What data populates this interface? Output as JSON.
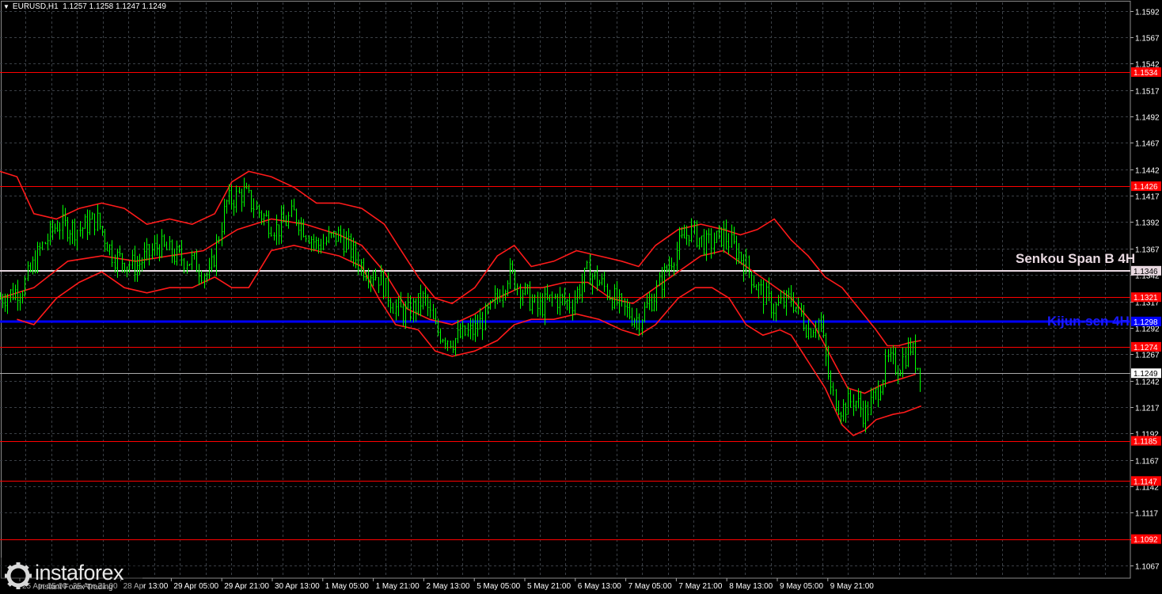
{
  "header": {
    "symbol": "EURUSD,H1",
    "ohlc": "1.1257 1.1258 1.1247 1.1249"
  },
  "watermark": {
    "brand": "instaforex",
    "tagline": "Instant Forex Trading"
  },
  "colors": {
    "background": "#000000",
    "grid": "#3a3f45",
    "candle": "#00ff00",
    "ichimoku": "#ff1a1a",
    "level": "#ff0000",
    "kijun": "#0000ff",
    "senkou": "#e8d8e0",
    "axis_text": "#ffffff",
    "price_tag_text": "#ffffff",
    "current_tag_bg": "#ffffff"
  },
  "chart_data": {
    "type": "candlestick",
    "ylim": [
      1.1055,
      1.16
    ],
    "y_ticks": [
      "1.1592",
      "1.1567",
      "1.1542",
      "1.1517",
      "1.1492",
      "1.1467",
      "1.1442",
      "1.1417",
      "1.1392",
      "1.1367",
      "1.1342",
      "1.1317",
      "1.1292",
      "1.1267",
      "1.1242",
      "1.1217",
      "1.1192",
      "1.1167",
      "1.1142",
      "1.1117",
      "1.1092",
      "1.1067"
    ],
    "x_ticks": [
      "25 Apr 05:00",
      "25 Apr 21:00",
      "28 Apr 13:00",
      "29 Apr 05:00",
      "29 Apr 21:00",
      "30 Apr 13:00",
      "1 May 05:00",
      "1 May 21:00",
      "2 May 13:00",
      "5 May 05:00",
      "5 May 21:00",
      "6 May 13:00",
      "7 May 05:00",
      "7 May 21:00",
      "8 May 13:00",
      "9 May 05:00",
      "9 May 21:00"
    ],
    "levels": [
      {
        "price": 1.1534,
        "label": "1.1534",
        "color": "#ff0000"
      },
      {
        "price": 1.1426,
        "label": "1.1426",
        "color": "#ff0000"
      },
      {
        "price": 1.1321,
        "label": "1.1321",
        "color": "#ff0000"
      },
      {
        "price": 1.1274,
        "label": "1.1274",
        "color": "#ff0000"
      },
      {
        "price": 1.1185,
        "label": "1.1185",
        "color": "#ff0000"
      },
      {
        "price": 1.1147,
        "label": "1.1147",
        "color": "#ff0000"
      },
      {
        "price": 1.1092,
        "label": "1.1092",
        "color": "#ff0000"
      }
    ],
    "kijun": {
      "price": 1.1298,
      "label": "1.1298",
      "name": "Kijun-sen 4H"
    },
    "senkou": {
      "price": 1.1346,
      "label": "1.1346",
      "name": "Senkou Span B 4H"
    },
    "current_price": {
      "price": 1.1249,
      "label": "1.1249"
    },
    "series": [
      {
        "name": "close_path",
        "points": [
          [
            0,
            1.132
          ],
          [
            0.02,
            1.133
          ],
          [
            0.035,
            1.1365
          ],
          [
            0.05,
            1.139
          ],
          [
            0.07,
            1.1385
          ],
          [
            0.085,
            1.1395
          ],
          [
            0.1,
            1.136
          ],
          [
            0.12,
            1.135
          ],
          [
            0.14,
            1.137
          ],
          [
            0.155,
            1.136
          ],
          [
            0.17,
            1.1355
          ],
          [
            0.185,
            1.134
          ],
          [
            0.2,
            1.141
          ],
          [
            0.215,
            1.142
          ],
          [
            0.23,
            1.14
          ],
          [
            0.245,
            1.1385
          ],
          [
            0.26,
            1.14
          ],
          [
            0.28,
            1.137
          ],
          [
            0.3,
            1.138
          ],
          [
            0.32,
            1.135
          ],
          [
            0.335,
            1.134
          ],
          [
            0.35,
            1.131
          ],
          [
            0.36,
            1.1305
          ],
          [
            0.375,
            1.132
          ],
          [
            0.385,
            1.129
          ],
          [
            0.4,
            1.128
          ],
          [
            0.42,
            1.129
          ],
          [
            0.435,
            1.131
          ],
          [
            0.45,
            1.1345
          ],
          [
            0.46,
            1.133
          ],
          [
            0.475,
            1.131
          ],
          [
            0.49,
            1.132
          ],
          [
            0.505,
            1.1315
          ],
          [
            0.52,
            1.1345
          ],
          [
            0.535,
            1.133
          ],
          [
            0.55,
            1.131
          ],
          [
            0.565,
            1.13
          ],
          [
            0.58,
            1.1325
          ],
          [
            0.595,
            1.136
          ],
          [
            0.61,
            1.1385
          ],
          [
            0.625,
            1.137
          ],
          [
            0.64,
            1.138
          ],
          [
            0.655,
            1.136
          ],
          [
            0.67,
            1.133
          ],
          [
            0.685,
            1.131
          ],
          [
            0.7,
            1.132
          ],
          [
            0.715,
            1.129
          ],
          [
            0.725,
            1.13
          ],
          [
            0.735,
            1.123
          ],
          [
            0.745,
            1.1215
          ],
          [
            0.755,
            1.1225
          ],
          [
            0.765,
            1.121
          ],
          [
            0.775,
            1.123
          ],
          [
            0.785,
            1.126
          ],
          [
            0.795,
            1.1255
          ],
          [
            0.805,
            1.1275
          ],
          [
            0.81,
            1.126
          ],
          [
            0.815,
            1.1249
          ]
        ]
      },
      {
        "name": "upper_band",
        "points": [
          [
            0,
            1.144
          ],
          [
            0.015,
            1.1435
          ],
          [
            0.03,
            1.14
          ],
          [
            0.05,
            1.1395
          ],
          [
            0.07,
            1.1405
          ],
          [
            0.09,
            1.141
          ],
          [
            0.11,
            1.1405
          ],
          [
            0.13,
            1.139
          ],
          [
            0.15,
            1.1395
          ],
          [
            0.17,
            1.139
          ],
          [
            0.19,
            1.14
          ],
          [
            0.205,
            1.143
          ],
          [
            0.22,
            1.144
          ],
          [
            0.24,
            1.1435
          ],
          [
            0.26,
            1.1425
          ],
          [
            0.28,
            1.141
          ],
          [
            0.3,
            1.141
          ],
          [
            0.32,
            1.1405
          ],
          [
            0.34,
            1.139
          ],
          [
            0.355,
            1.1365
          ],
          [
            0.37,
            1.134
          ],
          [
            0.385,
            1.132
          ],
          [
            0.4,
            1.1315
          ],
          [
            0.42,
            1.133
          ],
          [
            0.44,
            1.136
          ],
          [
            0.455,
            1.137
          ],
          [
            0.47,
            1.135
          ],
          [
            0.49,
            1.1355
          ],
          [
            0.51,
            1.1365
          ],
          [
            0.53,
            1.136
          ],
          [
            0.55,
            1.1355
          ],
          [
            0.565,
            1.135
          ],
          [
            0.58,
            1.137
          ],
          [
            0.6,
            1.1385
          ],
          [
            0.62,
            1.139
          ],
          [
            0.64,
            1.1385
          ],
          [
            0.655,
            1.138
          ],
          [
            0.67,
            1.1385
          ],
          [
            0.685,
            1.1395
          ],
          [
            0.7,
            1.1375
          ],
          [
            0.715,
            1.136
          ],
          [
            0.73,
            1.134
          ],
          [
            0.745,
            1.133
          ],
          [
            0.76,
            1.131
          ],
          [
            0.775,
            1.129
          ],
          [
            0.785,
            1.1275
          ],
          [
            0.795,
            1.1275
          ],
          [
            0.805,
            1.1278
          ],
          [
            0.815,
            1.128
          ]
        ]
      },
      {
        "name": "lower_band",
        "points": [
          [
            0.015,
            1.13
          ],
          [
            0.03,
            1.1295
          ],
          [
            0.05,
            1.132
          ],
          [
            0.07,
            1.1335
          ],
          [
            0.09,
            1.1345
          ],
          [
            0.11,
            1.133
          ],
          [
            0.13,
            1.1325
          ],
          [
            0.15,
            1.133
          ],
          [
            0.17,
            1.133
          ],
          [
            0.19,
            1.134
          ],
          [
            0.205,
            1.133
          ],
          [
            0.22,
            1.133
          ],
          [
            0.24,
            1.1365
          ],
          [
            0.26,
            1.137
          ],
          [
            0.28,
            1.1365
          ],
          [
            0.3,
            1.136
          ],
          [
            0.32,
            1.135
          ],
          [
            0.335,
            1.132
          ],
          [
            0.35,
            1.1295
          ],
          [
            0.37,
            1.129
          ],
          [
            0.385,
            1.127
          ],
          [
            0.4,
            1.1265
          ],
          [
            0.42,
            1.127
          ],
          [
            0.44,
            1.128
          ],
          [
            0.455,
            1.1295
          ],
          [
            0.47,
            1.13
          ],
          [
            0.49,
            1.13
          ],
          [
            0.51,
            1.1305
          ],
          [
            0.53,
            1.13
          ],
          [
            0.55,
            1.129
          ],
          [
            0.565,
            1.1285
          ],
          [
            0.58,
            1.1295
          ],
          [
            0.6,
            1.132
          ],
          [
            0.615,
            1.133
          ],
          [
            0.63,
            1.133
          ],
          [
            0.645,
            1.132
          ],
          [
            0.66,
            1.1295
          ],
          [
            0.675,
            1.1285
          ],
          [
            0.69,
            1.129
          ],
          [
            0.7,
            1.1285
          ],
          [
            0.715,
            1.126
          ],
          [
            0.73,
            1.1235
          ],
          [
            0.745,
            1.12
          ],
          [
            0.755,
            1.119
          ],
          [
            0.765,
            1.1195
          ],
          [
            0.775,
            1.1205
          ],
          [
            0.79,
            1.121
          ],
          [
            0.8,
            1.1212
          ],
          [
            0.815,
            1.1218
          ]
        ]
      },
      {
        "name": "mid_line",
        "points": [
          [
            0,
            1.132
          ],
          [
            0.03,
            1.133
          ],
          [
            0.06,
            1.1355
          ],
          [
            0.09,
            1.136
          ],
          [
            0.12,
            1.1355
          ],
          [
            0.15,
            1.136
          ],
          [
            0.18,
            1.1365
          ],
          [
            0.21,
            1.1385
          ],
          [
            0.24,
            1.1395
          ],
          [
            0.27,
            1.139
          ],
          [
            0.3,
            1.138
          ],
          [
            0.32,
            1.137
          ],
          [
            0.34,
            1.1345
          ],
          [
            0.36,
            1.131
          ],
          [
            0.38,
            1.13
          ],
          [
            0.4,
            1.1295
          ],
          [
            0.42,
            1.1305
          ],
          [
            0.44,
            1.132
          ],
          [
            0.46,
            1.133
          ],
          [
            0.48,
            1.133
          ],
          [
            0.5,
            1.1335
          ],
          [
            0.52,
            1.1335
          ],
          [
            0.54,
            1.132
          ],
          [
            0.56,
            1.1315
          ],
          [
            0.58,
            1.133
          ],
          [
            0.6,
            1.1345
          ],
          [
            0.62,
            1.136
          ],
          [
            0.64,
            1.1365
          ],
          [
            0.66,
            1.135
          ],
          [
            0.68,
            1.1335
          ],
          [
            0.7,
            1.132
          ],
          [
            0.72,
            1.1295
          ],
          [
            0.735,
            1.1265
          ],
          [
            0.75,
            1.1235
          ],
          [
            0.765,
            1.123
          ],
          [
            0.78,
            1.1238
          ],
          [
            0.795,
            1.1243
          ],
          [
            0.81,
            1.1248
          ]
        ]
      }
    ]
  }
}
